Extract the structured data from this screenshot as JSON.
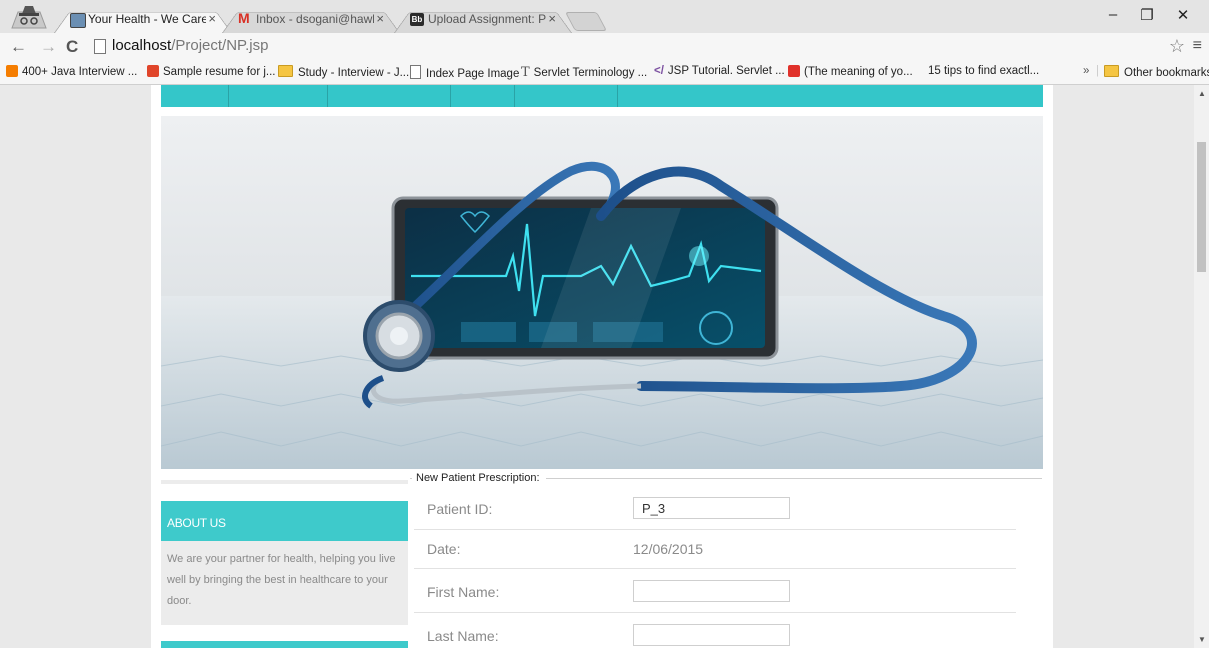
{
  "browser": {
    "tabs": [
      {
        "title": "Your Health - We Care!",
        "active": true
      },
      {
        "title": "Inbox - dsogani@hawk.iit.",
        "active": false
      },
      {
        "title": "Upload Assignment: Proje",
        "active": false
      }
    ],
    "tab_close": "×",
    "window": {
      "minimize": "–",
      "restore": "❐",
      "close": "✕"
    },
    "nav": {
      "back": "←",
      "forward": "→",
      "reload": "C"
    },
    "url": {
      "host": "localhost",
      "path": "/Project/NP.jsp"
    },
    "bookmark_star": "☆",
    "menu": "≡",
    "bookmarks": [
      {
        "label": "400+ Java Interview ...",
        "icon": "blogger-icon",
        "color": "#f57d00"
      },
      {
        "label": "Sample resume for j...",
        "icon": "c-icon",
        "color": "#e0452a"
      },
      {
        "label": "Study - Interview - J...",
        "icon": "folder-icon",
        "color": "#f5c542"
      },
      {
        "label": "Index Page Image",
        "icon": "page-icon",
        "color": "#ffffff"
      },
      {
        "label": "Servlet Terminology ...",
        "icon": "t-icon",
        "color": "#555555"
      },
      {
        "label": "JSP Tutorial. Servlet ...",
        "icon": "code-icon",
        "color": "#7b4fa0"
      },
      {
        "label": "(The meaning of yo...",
        "icon": "zmg-icon",
        "color": "#e0312a"
      },
      {
        "label": "15 tips to find exactl...",
        "icon": "none",
        "color": "#ffffff"
      }
    ],
    "bookmarks_overflow": "»",
    "other_bookmarks": "Other bookmarks"
  },
  "sidebar": {
    "about_title": "ABOUT US",
    "about_text": "We are your partner for health, helping you live well by bringing the best in healthcare to your door."
  },
  "form": {
    "legend": "New Patient Prescription:",
    "patient_id_label": "Patient ID:",
    "patient_id_value": "P_3",
    "date_label": "Date:",
    "date_value": "12/06/2015",
    "first_name_label": "First Name:",
    "first_name_value": "",
    "last_name_label": "Last Name:",
    "last_name_value": ""
  },
  "hero_image": {
    "icon": "stethoscope-tablet-ecg-image"
  },
  "colors": {
    "accent": "#3ecacb",
    "nav": "#34c6c9"
  }
}
